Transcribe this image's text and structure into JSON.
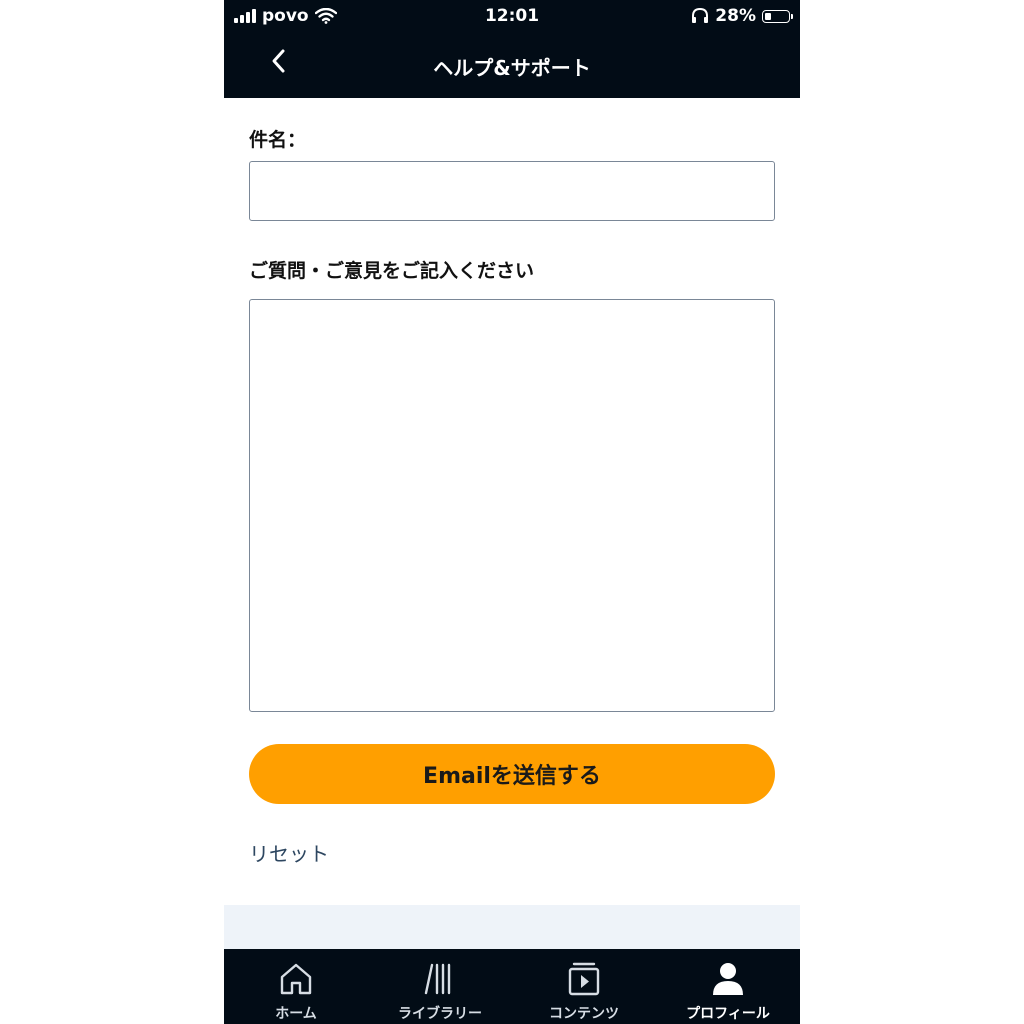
{
  "status_bar": {
    "carrier": "povo",
    "time": "12:01",
    "battery_percent": "28%",
    "battery_level": 0.28
  },
  "header": {
    "title": "ヘルプ&サポート",
    "back_icon": "chevron-left-icon"
  },
  "form": {
    "subject_label": "件名：",
    "subject_value": "",
    "message_label": "ご質問・ご意見をご記入ください",
    "message_value": "",
    "send_label": "Emailを送信する",
    "reset_label": "リセット"
  },
  "tabs": [
    {
      "label": "ホーム",
      "icon": "home-icon",
      "active": false
    },
    {
      "label": "ライブラリー",
      "icon": "library-icon",
      "active": false
    },
    {
      "label": "コンテンツ",
      "icon": "play-icon",
      "active": false
    },
    {
      "label": "プロフィール",
      "icon": "profile-icon",
      "active": true
    }
  ],
  "colors": {
    "header_bg": "#020c16",
    "accent": "#ff9f00",
    "link": "#2d4660"
  }
}
